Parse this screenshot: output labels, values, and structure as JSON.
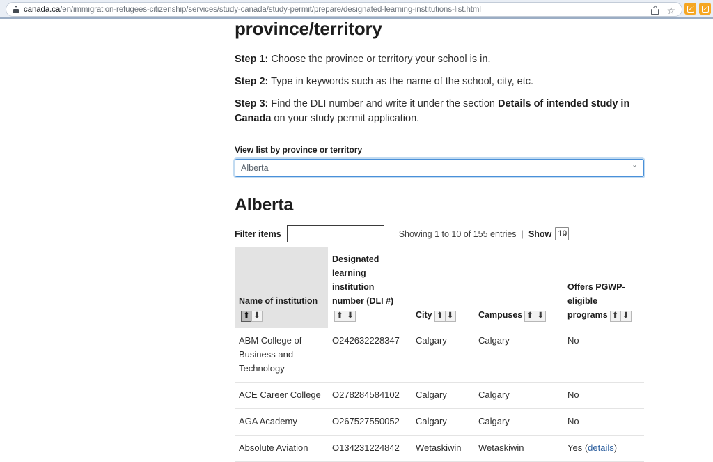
{
  "browser": {
    "url_host": "canada.ca",
    "url_path": "/en/immigration-refugees-citizenship/services/study-canada/study-permit/prepare/designated-learning-institutions-list.html",
    "lock_icon": "lock-icon",
    "share_icon": "share-icon",
    "bookmark_icon": "☆",
    "extensions": [
      "extension-badge-1",
      "extension-badge-2"
    ]
  },
  "content": {
    "heading": "province/territory",
    "steps": [
      {
        "label": "Step 1:",
        "text": " Choose the province or territory your school is in."
      },
      {
        "label": "Step 2:",
        "text": " Type in keywords such as the name of the school, city, etc."
      }
    ],
    "step3": {
      "label": "Step 3:",
      "text_before": " Find the DLI number and write it under the section ",
      "bold_part": "Details of intended study in Canada",
      "text_after": " on your study permit application."
    },
    "province_field": {
      "label": "View list by province or territory",
      "selected": "Alberta",
      "chevron": "⌄"
    },
    "province_heading": "Alberta"
  },
  "table_controls": {
    "filter_label": "Filter items",
    "filter_value": "",
    "filter_placeholder": "",
    "showing_text": "Showing 1 to 10 of 155 entries",
    "divider": "|",
    "show_label": "Show",
    "page_length": "10",
    "chevron": "⌄"
  },
  "table": {
    "columns": [
      {
        "label": "Name of institution",
        "sorted": true,
        "sort_asc_active": true
      },
      {
        "label": "Designated learning institution number (DLI #)",
        "sorted": false,
        "sort_asc_active": false
      },
      {
        "label": "City",
        "sorted": false,
        "sort_asc_active": false
      },
      {
        "label": "Campuses",
        "sorted": false,
        "sort_asc_active": false
      },
      {
        "label": "Offers PGWP-eligible programs",
        "sorted": false,
        "sort_asc_active": false
      }
    ],
    "sort_asc_icon": "⬆",
    "sort_desc_icon": "⬇",
    "rows": [
      {
        "name": "ABM College of Business and Technology",
        "dli": "O242632228347",
        "city": "Calgary",
        "campuses": "Calgary",
        "pgwp": "No",
        "pgwp_link": null
      },
      {
        "name": "ACE Career College",
        "dli": "O278284584102",
        "city": "Calgary",
        "campuses": "Calgary",
        "pgwp": "No",
        "pgwp_link": null
      },
      {
        "name": "AGA Academy",
        "dli": "O267527550052",
        "city": "Calgary",
        "campuses": "Calgary",
        "pgwp": "No",
        "pgwp_link": null
      },
      {
        "name": "Absolute Aviation",
        "dli": "O134231224842",
        "city": "Wetaskiwin",
        "campuses": "Wetaskiwin",
        "pgwp": "Yes (",
        "pgwp_link": "details",
        "pgwp_suffix": ")"
      }
    ]
  },
  "colors": {
    "focus_blue": "#4a90d9",
    "link_blue": "#2b5e9e",
    "header_gray": "#e3e3e3",
    "extension_orange": "#f5a623",
    "chrome_bg": "#e9eef5"
  }
}
